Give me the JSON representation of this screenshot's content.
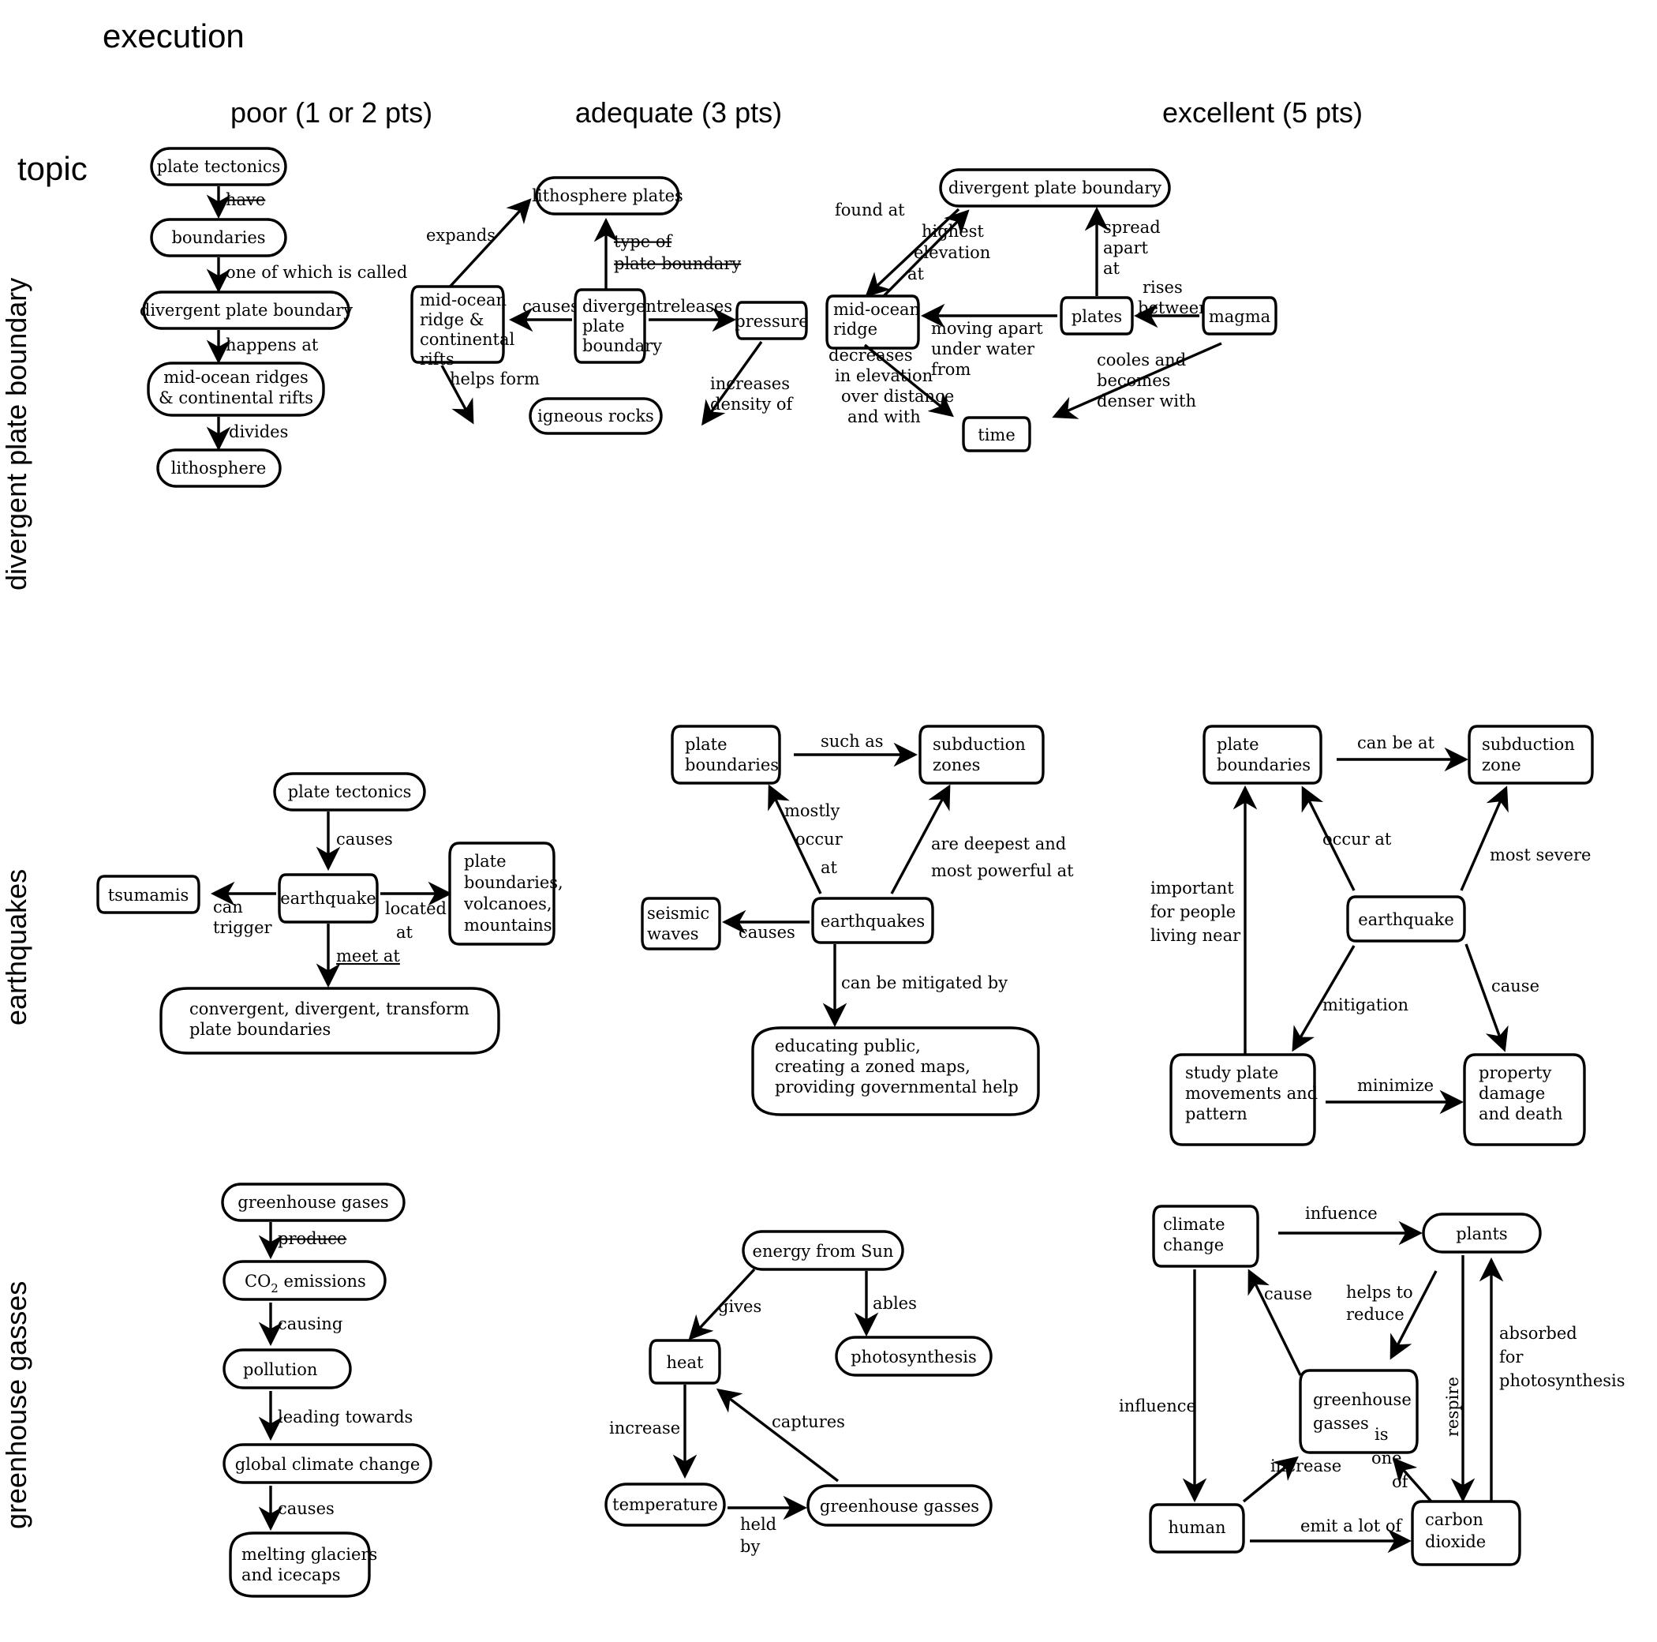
{
  "header": {
    "execution_label": "execution",
    "topic_label": "topic",
    "columns": [
      {
        "id": "poor",
        "label": "poor (1 or 2 pts)"
      },
      {
        "id": "adequate",
        "label": "adequate (3 pts)"
      },
      {
        "id": "excellent",
        "label": "excellent (5 pts)"
      }
    ],
    "rows": [
      {
        "id": "divergent",
        "label": "divergent plate boundary"
      },
      {
        "id": "earthquakes",
        "label": "earthquakes"
      },
      {
        "id": "greenhouse",
        "label": "greenhouse gasses"
      }
    ]
  },
  "maps": {
    "r0c0": {
      "nodes": {
        "n1": "plate tectonics",
        "n2": "boundaries",
        "n3": "divergent plate boundary",
        "n4a": "mid-ocean ridges",
        "n4b": "& continental rifts",
        "n5": "lithosphere"
      },
      "links": {
        "l1": "have",
        "l2": "one of which is called",
        "l3": "happens at",
        "l4": "divides"
      }
    },
    "r0c1": {
      "nodes": {
        "lith": "lithosphere plates",
        "mor1": "mid-ocean",
        "mor2": "ridge &",
        "mor3": "continental",
        "mor4": "rifts",
        "dpb1": "divergent",
        "dpb2": "plate",
        "dpb3": "boundary",
        "press": "pressure",
        "igne": "igneous rocks"
      },
      "links": {
        "expands": "expands",
        "type1": "type of",
        "type2": "plate boundary",
        "causes": "causes",
        "releases": "releases",
        "helps": "helps form",
        "dens1": "increases",
        "dens2": "density of"
      }
    },
    "r0c2": {
      "nodes": {
        "dpb": "divergent plate boundary",
        "mor1": "mid-ocean",
        "mor2": "ridge",
        "plates": "plates",
        "magma": "magma",
        "time": "time"
      },
      "links": {
        "found": "found at",
        "high1": "highest",
        "high2": "elevation",
        "high3": "at",
        "spread1": "spread",
        "spread2": "apart",
        "spread3": "at",
        "rises1": "rises",
        "rises2": "between",
        "moving1": "moving apart",
        "moving2": "under water",
        "moving3": "from",
        "dec1": "decreases",
        "dec2": "in elevation",
        "dec3": "over distance",
        "dec4": "and with",
        "cool1": "cooles and",
        "cool2": "becomes",
        "cool3": "denser with"
      }
    },
    "r1c0": {
      "nodes": {
        "pt": "plate tectonics",
        "eq": "earthquake",
        "tsu": "tsumamis",
        "pb1": "plate",
        "pb2": "boundaries,",
        "pb3": "volcanoes,",
        "pb4": "mountains",
        "cdt1": "convergent, divergent, transform",
        "cdt2": "plate boundaries"
      },
      "links": {
        "causes": "causes",
        "trig1": "can",
        "trig2": "trigger",
        "loc1": "located",
        "loc2": "at",
        "meet": "meet at"
      }
    },
    "r1c1": {
      "nodes": {
        "pb1": "plate",
        "pb2": "boundaries",
        "sz1": "subduction",
        "sz2": "zones",
        "sw1": "seismic",
        "sw2": "waves",
        "eq": "earthquakes",
        "ed1": "educating public,",
        "ed2": "creating a zoned maps,",
        "ed3": "providing governmental help"
      },
      "links": {
        "such": "such as",
        "most1": "mostly",
        "most2": "occur",
        "most3": "at",
        "deep1": "are deepest and",
        "deep2": "most powerful at",
        "causes": "causes",
        "mit": "can be mitigated by"
      }
    },
    "r1c2": {
      "nodes": {
        "pb1": "plate",
        "pb2": "boundaries",
        "sz1": "subduction",
        "sz2": "zone",
        "eq": "earthquake",
        "sp1": "study plate",
        "sp2": "movements and",
        "sp3": "pattern",
        "pd1": "property",
        "pd2": "damage",
        "pd3": "and death"
      },
      "links": {
        "canbe": "can be at",
        "occur": "occur at",
        "severe": "most severe",
        "imp1": "important",
        "imp2": "for people",
        "imp3": "living near",
        "mitigation": "mitigation",
        "cause": "cause",
        "minimize": "minimize"
      }
    },
    "r2c0": {
      "nodes": {
        "gg": "greenhouse gases",
        "co2": "CO",
        "co2sub": "2",
        "co2rest": " emissions",
        "poll": "pollution",
        "gcc": "global climate change",
        "mg1": "melting glaciers",
        "mg2": "and icecaps"
      },
      "links": {
        "produce": "produce",
        "causing": "causing",
        "leading": "leading towards",
        "causes": "causes"
      }
    },
    "r2c1": {
      "nodes": {
        "sun": "energy from Sun",
        "heat": "heat",
        "photo": "photosynthesis",
        "temp": "temperature",
        "ghg": "greenhouse gasses"
      },
      "links": {
        "gives": "gives",
        "ables": "ables",
        "increase": "increase",
        "captures": "captures",
        "held1": "held",
        "held2": "by"
      }
    },
    "r2c2": {
      "nodes": {
        "cc1": "climate",
        "cc2": "change",
        "plants": "plants",
        "ghg1": "greenhouse",
        "ghg2": "gasses",
        "human": "human",
        "cd1": "carbon",
        "cd2": "dioxide"
      },
      "links": {
        "infuence": "infuence",
        "cause": "cause",
        "helps1": "helps to",
        "helps2": "reduce",
        "influence": "influence",
        "respire": "respire",
        "abs1": "absorbed",
        "abs2": "for",
        "abs3": "photosynthesis",
        "increase": "increase",
        "is1": "is",
        "is2": "one",
        "is3": "of",
        "emit": "emit a lot of"
      }
    }
  }
}
